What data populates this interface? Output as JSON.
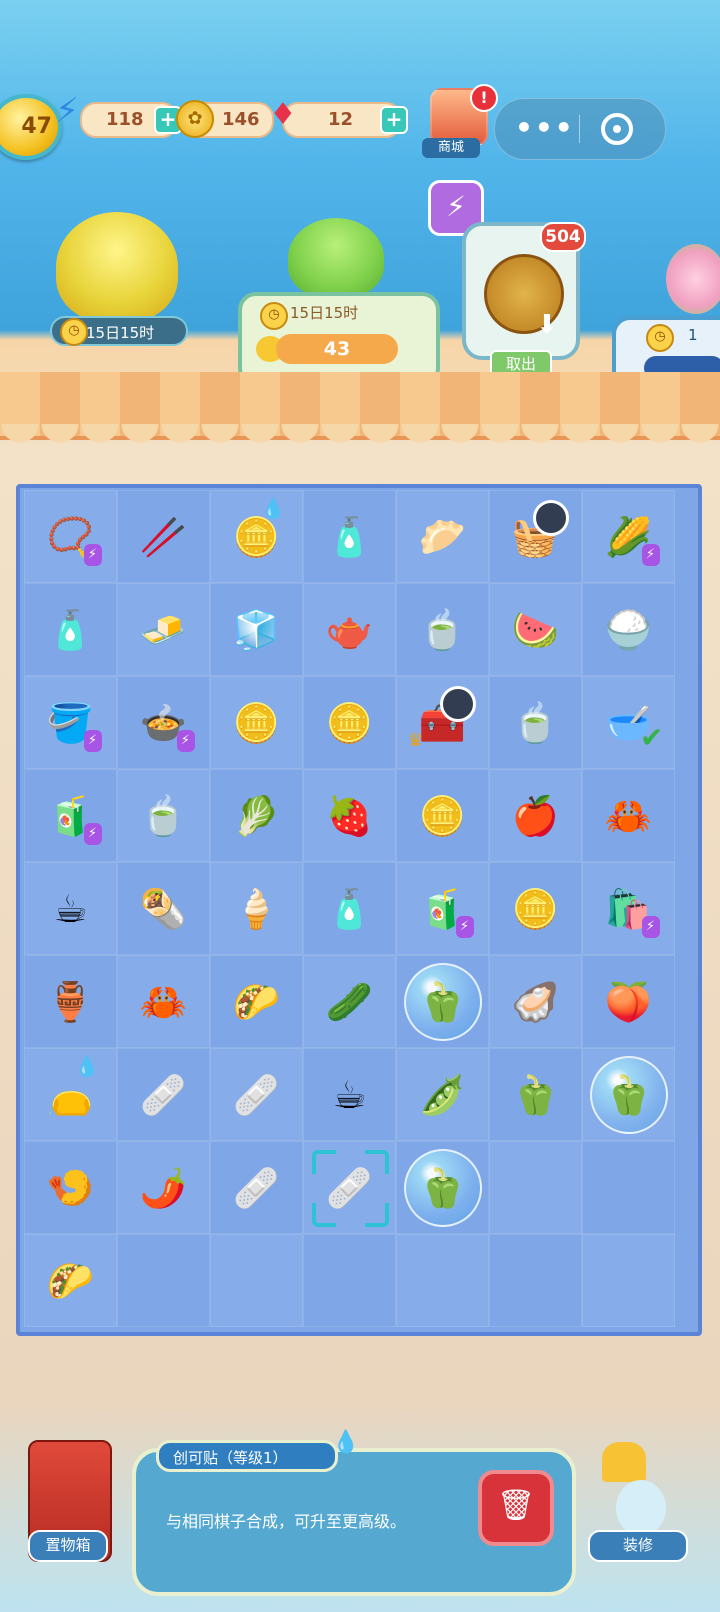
{
  "top_bar": {
    "level": "47",
    "energy": "118",
    "coins": "146",
    "gems": "12",
    "shop_label": "商城",
    "alert": "!"
  },
  "characters": {
    "left_timer": "15日15时",
    "center_timer": "15日15时",
    "center_count": "43",
    "storage_count": "504",
    "take_out_label": "取出",
    "right_partial_value": "1"
  },
  "board": {
    "rows": [
      [
        {
          "icon": "📿",
          "name": "goldfish-bag"
        },
        {
          "icon": "🥢",
          "name": "cotton-swabs"
        },
        {
          "icon": "🪙",
          "name": "coin-gem-pile"
        },
        {
          "icon": "🧴",
          "name": "medicine-bottle"
        },
        {
          "icon": "🥟",
          "name": "steamed-bun"
        },
        {
          "icon": "🧺",
          "name": "cherry-basket"
        },
        {
          "icon": "🌽",
          "name": "corn-basket"
        }
      ],
      [
        {
          "icon": "🧴",
          "name": "iodine-bottle"
        },
        {
          "icon": "🧈",
          "name": "tofu"
        },
        {
          "icon": "🧊",
          "name": "blue-fridge"
        },
        {
          "icon": "🫖",
          "name": "teapot"
        },
        {
          "icon": "🍵",
          "name": "tea-bowl"
        },
        {
          "icon": "🍉",
          "name": "watermelon-slice"
        },
        {
          "icon": "🍚",
          "name": "fried-rice"
        }
      ],
      [
        {
          "icon": "🪣",
          "name": "water-bucket"
        },
        {
          "icon": "🍲",
          "name": "clay-pot"
        },
        {
          "icon": "🪙",
          "name": "gold-coin"
        },
        {
          "icon": "🪙",
          "name": "coin-stack"
        },
        {
          "icon": "🧰",
          "name": "first-aid-box"
        },
        {
          "icon": "🍵",
          "name": "tea-bowl"
        },
        {
          "icon": "🥣",
          "name": "soup-bowl"
        }
      ],
      [
        {
          "icon": "🧃",
          "name": "juicer"
        },
        {
          "icon": "🍵",
          "name": "tea-bowl"
        },
        {
          "icon": "🥬",
          "name": "cabbage"
        },
        {
          "icon": "🍓",
          "name": "strawberry"
        },
        {
          "icon": "🪙",
          "name": "coin-pair"
        },
        {
          "icon": "🍎",
          "name": "apple"
        },
        {
          "icon": "🦀",
          "name": "crab"
        }
      ],
      [
        {
          "icon": "☕",
          "name": "tea-cup"
        },
        {
          "icon": "🌯",
          "name": "spring-rolls"
        },
        {
          "icon": "🍦",
          "name": "ice-cream"
        },
        {
          "icon": "🧴",
          "name": "medicine-bottle"
        },
        {
          "icon": "🧃",
          "name": "juicer"
        },
        {
          "icon": "🪙",
          "name": "coin-token"
        },
        {
          "icon": "🛍️",
          "name": "shopping-bag"
        }
      ],
      [
        {
          "icon": "🏺",
          "name": "gold-vase"
        },
        {
          "icon": "🦀",
          "name": "crab"
        },
        {
          "icon": "🌮",
          "name": "taco"
        },
        {
          "icon": "🥒",
          "name": "cucumber"
        },
        {
          "icon": "🫑",
          "name": "pepper-bubble"
        },
        {
          "icon": "🦪",
          "name": "oysters"
        },
        {
          "icon": "🍑",
          "name": "peach"
        }
      ],
      [
        {
          "icon": "👝",
          "name": "lucky-bag"
        },
        {
          "icon": "🩹",
          "name": "bandage"
        },
        {
          "icon": "🩹",
          "name": "bandage"
        },
        {
          "icon": "☕",
          "name": "lemon-tea"
        },
        {
          "icon": "🫛",
          "name": "peas"
        },
        {
          "icon": "🫑",
          "name": "green-pepper"
        },
        {
          "icon": "🫑",
          "name": "pepper-bubble"
        }
      ],
      [
        {
          "icon": "🍤",
          "name": "fried-shrimp"
        },
        {
          "icon": "🌶️",
          "name": "chili"
        },
        {
          "icon": "🩹",
          "name": "bandage"
        },
        {
          "icon": "🩹",
          "name": "bandage-selected"
        },
        {
          "icon": "🫑",
          "name": "pepper-bubble"
        },
        {
          "icon": "",
          "name": "empty"
        },
        {
          "icon": "",
          "name": "empty"
        }
      ],
      [
        {
          "icon": "🌮",
          "name": "taco"
        },
        {
          "icon": "",
          "name": "empty"
        },
        {
          "icon": "",
          "name": "empty"
        },
        {
          "icon": "",
          "name": "empty"
        },
        {
          "icon": "",
          "name": "empty"
        },
        {
          "icon": "",
          "name": "empty"
        },
        {
          "icon": "",
          "name": "empty"
        }
      ]
    ]
  },
  "info_panel": {
    "title": "创可贴（等级1）",
    "description": "与相同棋子合成，可升至更高级。"
  },
  "bottom": {
    "toolbox_label": "置物箱",
    "decorate_label": "装修"
  },
  "colors": {
    "board_bg": "#7fa7e8",
    "accent_teal": "#2ec2d4",
    "bolt_purple": "#a855e6",
    "trash_red": "#d8333b"
  }
}
